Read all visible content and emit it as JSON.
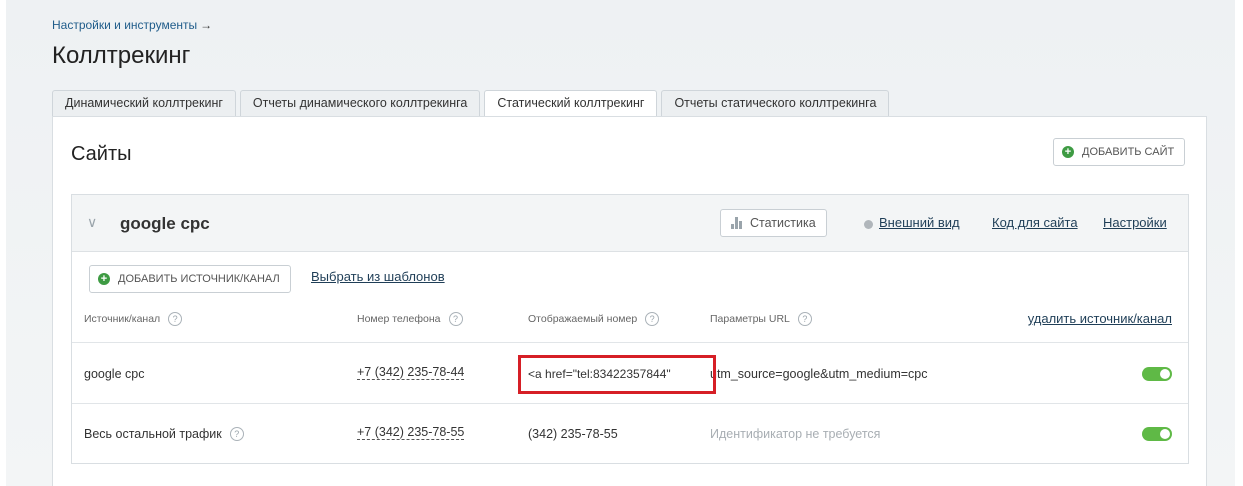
{
  "breadcrumb": {
    "label": "Настройки и инструменты",
    "arrow": "→"
  },
  "page_title": "Коллтрекинг",
  "tabs": [
    {
      "label": "Динамический коллтрекинг",
      "active": false
    },
    {
      "label": "Отчеты динамического коллтрекинга",
      "active": false
    },
    {
      "label": "Статический коллтрекинг",
      "active": true
    },
    {
      "label": "Отчеты статического коллтрекинга",
      "active": false
    }
  ],
  "section": {
    "title": "Сайты",
    "add_site_label": "ДОБАВИТЬ САЙТ"
  },
  "site": {
    "name": "google cpc",
    "stats_label": "Статистика",
    "appearance_label": "Внешний вид",
    "code_label": "Код для сайта",
    "settings_label": "Настройки",
    "add_source_label": "ДОБАВИТЬ ИСТОЧНИК/КАНАЛ",
    "templates_label": "Выбрать из шаблонов",
    "delete_source_label": "удалить источник/канал",
    "columns": {
      "source": "Источник/канал",
      "phone": "Номер телефона",
      "display": "Отображаемый номер",
      "url": "Параметры URL",
      "help": "?"
    },
    "rows": [
      {
        "source": "google cpc",
        "phone": "+7 (342) 235-78-44",
        "display": "<a href=\"tel:83422357844\"",
        "url": "utm_source=google&utm_medium=cpc",
        "enabled": true
      },
      {
        "source": "Весь остальной трафик",
        "phone": "+7 (342) 235-78-55",
        "display": "(342) 235-78-55",
        "url": "Идентификатор не требуется",
        "enabled": true
      }
    ]
  },
  "colors": {
    "accent_green": "#5fb946",
    "highlight_red": "#d61f26",
    "link_blue": "#1f5c8a"
  }
}
